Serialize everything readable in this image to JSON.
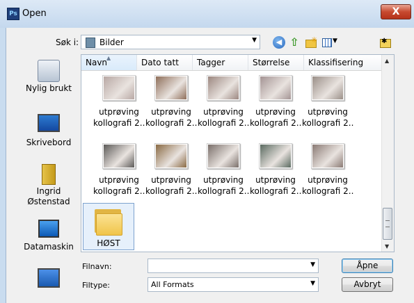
{
  "window": {
    "app_icon": "Ps",
    "title": "Open",
    "close_glyph": "X"
  },
  "toolbar": {
    "look_in_label": "Søk i:",
    "look_in_value": "Bilder",
    "icons": [
      "back-icon",
      "up-folder-icon",
      "new-folder-icon",
      "views-menu-icon",
      "desktop-icon"
    ]
  },
  "places": [
    {
      "label": "Nylig brukt",
      "icon": "recent-places-icon"
    },
    {
      "label": "Skrivebord",
      "icon": "desktop-icon"
    },
    {
      "label": "Ingrid\nØstenstad",
      "icon": "user-folder-icon"
    },
    {
      "label": "Datamaskin",
      "icon": "computer-icon"
    },
    {
      "label": "",
      "icon": "network-icon"
    }
  ],
  "columns": [
    "Navn",
    "Dato tatt",
    "Tagger",
    "Størrelse",
    "Klassifisering"
  ],
  "files": [
    {
      "line1": "utprøving",
      "line2": "kollografi 2...",
      "tint": "#b8a8a4"
    },
    {
      "line1": "utprøving",
      "line2": "kollografi 2...",
      "tint": "#8f6f5a"
    },
    {
      "line1": "utprøving",
      "line2": "kollografi 2...",
      "tint": "#9c8780"
    },
    {
      "line1": "utprøving",
      "line2": "kollografi 2...",
      "tint": "#a49494"
    },
    {
      "line1": "utprøving",
      "line2": "kollografi 2...",
      "tint": "#9a8f88"
    },
    {
      "line1": "utprøving",
      "line2": "kollografi 2...",
      "tint": "#5c5a58"
    },
    {
      "line1": "utprøving",
      "line2": "kollografi 2...",
      "tint": "#8a6a44"
    },
    {
      "line1": "utprøving",
      "line2": "kollografi 2...",
      "tint": "#7a6f6a"
    },
    {
      "line1": "utprøving",
      "line2": "kollografi 2...",
      "tint": "#5a6a60"
    },
    {
      "line1": "utprøving",
      "line2": "kollografi 2...",
      "tint": "#8a7a74"
    }
  ],
  "folder": {
    "label": "HØST"
  },
  "filename": {
    "label": "Filnavn:",
    "value": ""
  },
  "filetype": {
    "label": "Filtype:",
    "value": "All Formats"
  },
  "buttons": {
    "open": "Åpne",
    "cancel": "Avbryt"
  },
  "colors": {
    "accent": "#3c7fb1",
    "close": "#c74a2f"
  }
}
